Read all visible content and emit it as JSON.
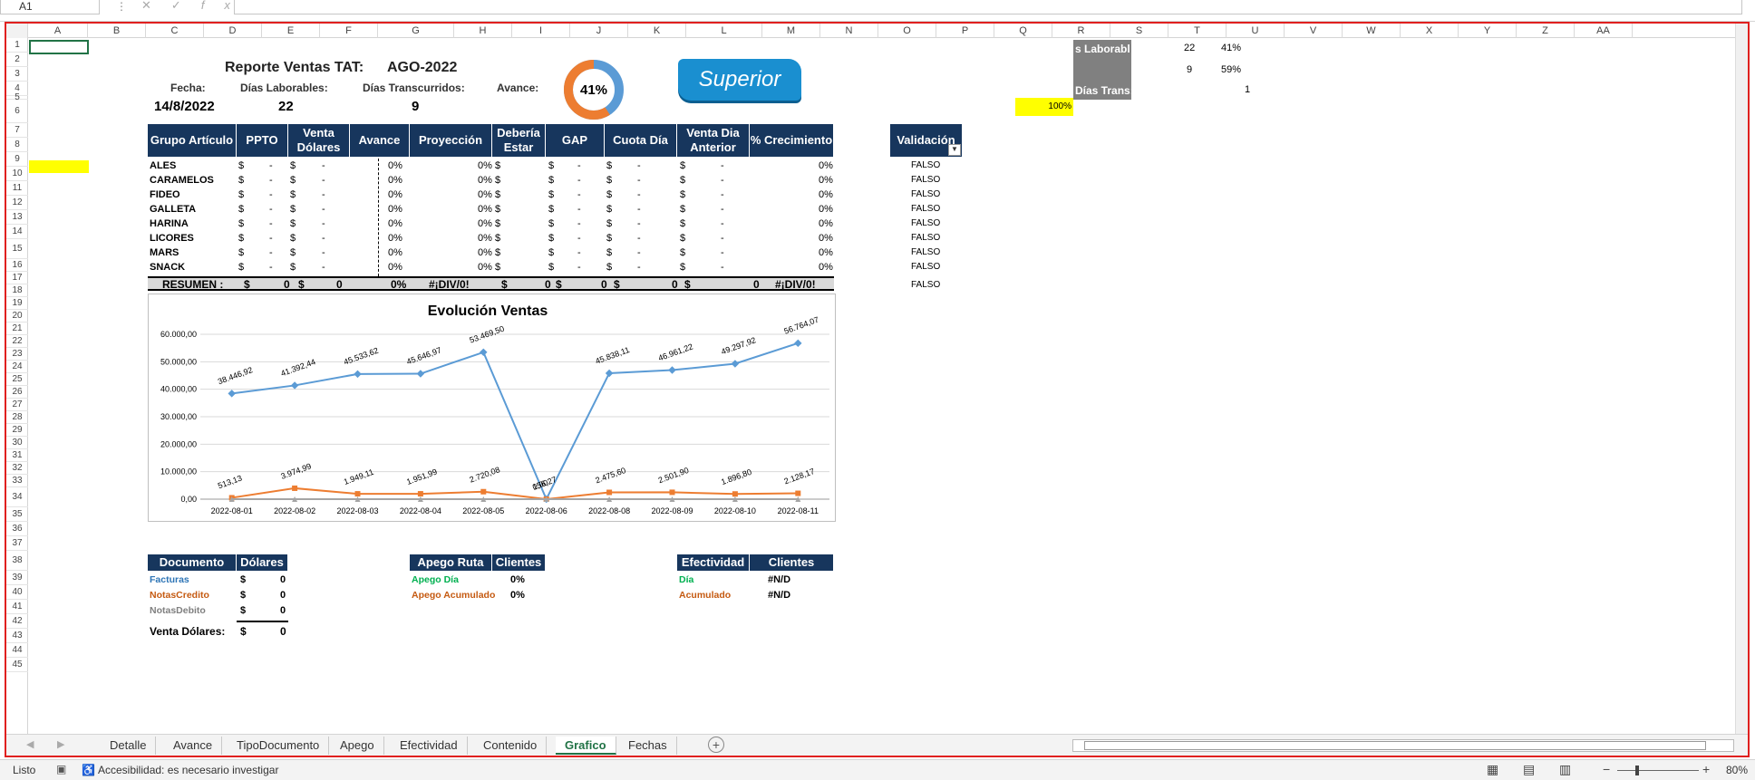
{
  "formula_bar": {
    "cell_ref": "A1",
    "cancel": "✕",
    "confirm": "✓",
    "fx": "fx"
  },
  "columns": [
    "A",
    "B",
    "C",
    "D",
    "E",
    "F",
    "G",
    "H",
    "I",
    "J",
    "K",
    "L",
    "M",
    "N",
    "O",
    "P",
    "Q",
    "R",
    "S",
    "T",
    "U",
    "V",
    "W",
    "X",
    "Y",
    "Z",
    "AA"
  ],
  "rows": [
    "1",
    "2",
    "3",
    "4",
    "5",
    "6",
    "7",
    "8",
    "9",
    "10",
    "11",
    "12",
    "13",
    "14",
    "15",
    "16",
    "17",
    "18",
    "19",
    "20",
    "21",
    "22",
    "23",
    "24",
    "25",
    "26",
    "27",
    "28",
    "29",
    "30",
    "31",
    "32",
    "33",
    "34",
    "35",
    "36",
    "37",
    "38",
    "39",
    "40",
    "41",
    "42",
    "43",
    "44",
    "45"
  ],
  "report": {
    "title": "Reporte Ventas TAT:",
    "period": "AGO-2022",
    "fecha_label": "Fecha:",
    "fecha": "14/8/2022",
    "dias_lab_label": "Días Laborables:",
    "dias_lab": "22",
    "dias_trans_label": "Días Transcurridos:",
    "dias_trans": "9",
    "avance_label": "Avance:",
    "avance_pct": "41%",
    "logo_text": "Superior"
  },
  "side": {
    "labor_label": "s Laborabl",
    "labor_val": "22",
    "labor_pct": "41%",
    "trans_val": "9",
    "trans_pct": "59%",
    "dias_trans_label": "Días Trans:",
    "dias_trans_val": "1",
    "yellow_pct": "100%"
  },
  "table": {
    "headers": [
      "Grupo Artículo",
      "PPTO",
      "Venta Dólares",
      "Avance",
      "Proyección",
      "Debería Estar",
      "GAP",
      "Cuota Día",
      "Venta Dia Anterior",
      "% Crecimiento"
    ],
    "rows": [
      {
        "name": "ALES",
        "avance": "0%",
        "proy": "0%",
        "crec": "0%",
        "valid": "FALSO"
      },
      {
        "name": "CARAMELOS",
        "avance": "0%",
        "proy": "0%",
        "crec": "0%",
        "valid": "FALSO"
      },
      {
        "name": "FIDEO",
        "avance": "0%",
        "proy": "0%",
        "crec": "0%",
        "valid": "FALSO"
      },
      {
        "name": "GALLETA",
        "avance": "0%",
        "proy": "0%",
        "crec": "0%",
        "valid": "FALSO"
      },
      {
        "name": "HARINA",
        "avance": "0%",
        "proy": "0%",
        "crec": "0%",
        "valid": "FALSO"
      },
      {
        "name": "LICORES",
        "avance": "0%",
        "proy": "0%",
        "crec": "0%",
        "valid": "FALSO"
      },
      {
        "name": "MARS",
        "avance": "0%",
        "proy": "0%",
        "crec": "0%",
        "valid": "FALSO"
      },
      {
        "name": "SNACK",
        "avance": "0%",
        "proy": "0%",
        "crec": "0%",
        "valid": "FALSO"
      }
    ],
    "currency": "$",
    "dash": "-",
    "validacion_header": "Validación",
    "resumen": {
      "label": "RESUMEN :",
      "ppto": "0",
      "venta": "0",
      "avance": "0%",
      "proy": "#¡DIV/0!",
      "deberia": "0",
      "gap": "0",
      "cuota": "0",
      "vda": "0",
      "crec": "#¡DIV/0!",
      "valid": "FALSO"
    }
  },
  "chart_data": {
    "type": "line",
    "title": "Evolución Ventas",
    "categories": [
      "2022-08-01",
      "2022-08-02",
      "2022-08-03",
      "2022-08-04",
      "2022-08-05",
      "2022-08-06",
      "2022-08-08",
      "2022-08-09",
      "2022-08-10",
      "2022-08-11"
    ],
    "ylim": [
      0,
      60000
    ],
    "yticks": [
      "0,00",
      "10.000,00",
      "20.000,00",
      "30.000,00",
      "40.000,00",
      "50.000,00",
      "60.000,00"
    ],
    "series": [
      {
        "color": "#5b9bd5",
        "values": [
          38446.92,
          41392.44,
          45533.62,
          45646.97,
          53469.5,
          0,
          45838.11,
          46961.22,
          49297.92,
          56764.07
        ],
        "labels": [
          "38.446,92",
          "41.392,44",
          "45.533,62",
          "45.646,97",
          "53.469,50",
          "0,00",
          "45.838,11",
          "46.961,22",
          "49.297,92",
          "56.764,07"
        ]
      },
      {
        "color": "#ed7d31",
        "values": [
          513.13,
          3974.99,
          1949.11,
          1951.99,
          2720.08,
          0,
          2475.6,
          2501.9,
          1896.8,
          2128.17
        ],
        "labels": [
          "513,13",
          "3.974,99",
          "1.949,11",
          "1.951,99",
          "2.720,08",
          "156,27",
          "2.475,60",
          "2.501,90",
          "1.896,80",
          "2.128,17"
        ]
      },
      {
        "color": "#a5a5a5",
        "values": [
          0,
          0,
          0,
          0,
          0,
          0,
          0,
          0,
          0,
          0
        ]
      }
    ],
    "grid": true
  },
  "doc_table": {
    "headers": [
      "Documento",
      "Dólares"
    ],
    "rows": [
      {
        "name": "Facturas",
        "color": "#2e75b6",
        "val": "0"
      },
      {
        "name": "NotasCredito",
        "color": "#c55a11",
        "val": "0"
      },
      {
        "name": "NotasDebito",
        "color": "#7f7f7f",
        "val": "0"
      }
    ],
    "total_label": "Venta Dólares:",
    "total": "0"
  },
  "apego_table": {
    "headers": [
      "Apego Ruta",
      "Clientes"
    ],
    "rows": [
      {
        "name": "Apego Día",
        "color": "#00b050",
        "val": "0%"
      },
      {
        "name": "Apego Acumulado",
        "color": "#c55a11",
        "val": "0%"
      }
    ]
  },
  "efect_table": {
    "headers": [
      "Efectividad",
      "Clientes"
    ],
    "rows": [
      {
        "name": "Día",
        "color": "#00b050",
        "val": "#N/D"
      },
      {
        "name": "Acumulado",
        "color": "#c55a11",
        "val": "#N/D"
      }
    ]
  },
  "tabs": [
    "Detalle",
    "Avance",
    "TipoDocumento",
    "Apego",
    "Efectividad",
    "Contenido",
    "Grafico",
    "Fechas"
  ],
  "active_tab": "Grafico",
  "status": {
    "ready": "Listo",
    "accessibility": "Accesibilidad: es necesario investigar",
    "zoom": "80%"
  }
}
